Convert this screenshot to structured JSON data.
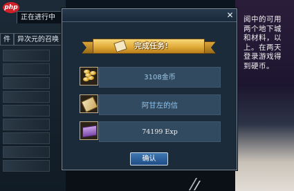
{
  "background": {
    "logo_text": "php",
    "tab_title": "正在进行中",
    "tabs": [
      "件",
      "异次元的召唤"
    ],
    "right_text": "阅中的可用两个地下城和材料，以上。在两天登录游戏得到硬币。"
  },
  "dialog": {
    "close_label": "✕",
    "banner_title": "完成任务!",
    "rewards": [
      {
        "icon": "gold-coins-icon",
        "label": "3108金币"
      },
      {
        "icon": "letter-icon",
        "label": "阿甘左的信"
      },
      {
        "icon": "book-icon",
        "label": "74199 Exp"
      }
    ],
    "confirm_label": "确认"
  },
  "colors": {
    "banner_gold": "#e1ac39",
    "panel_blue": "#324a60",
    "button_blue": "#2a5f9b"
  }
}
